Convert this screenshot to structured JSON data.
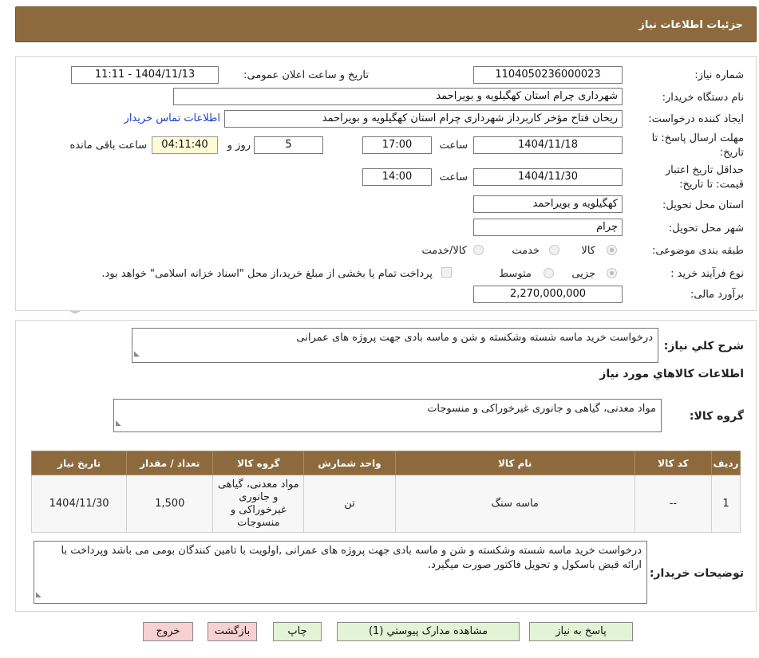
{
  "header": {
    "title": "جزئیات اطلاعات نیاز"
  },
  "watermark": {
    "text": "AriaTender.neT"
  },
  "form": {
    "need_number_label": "شماره نیاز:",
    "need_number": "1104050236000023",
    "announce_label": "تاریخ و ساعت اعلان عمومی:",
    "announce_value": "1404/11/13 - 11:11",
    "buyer_label": "نام دستگاه خریدار:",
    "buyer_value": "شهرداری چرام استان کهگیلویه و بویراحمد",
    "creator_label": "ایجاد کننده درخواست:",
    "creator_value": "ریحان فتاح مؤخر کاربرداز شهرداری چرام استان کهگیلویه و بویراحمد",
    "contact_link": "اطلاعات تماس خریدار",
    "deadline_label_1": "مهلت ارسال پاسخ: تا",
    "deadline_label_2": "تاریخ:",
    "deadline_date": "1404/11/18",
    "time_label": "ساعت",
    "deadline_time": "17:00",
    "days_value": "5",
    "days_label": "روز و",
    "remaining_time": "04:11:40",
    "remaining_label": "ساعت باقی مانده",
    "validity_label_1": "حداقل تاریخ اعتبار",
    "validity_label_2": "قیمت: تا تاریخ:",
    "validity_date": "1404/11/30",
    "validity_time": "14:00",
    "province_label": "استان محل تحویل:",
    "province_value": "کهگیلویه و بویراحمد",
    "city_label": "شهر محل تحویل:",
    "city_value": "چرام",
    "category_label": "طبقه بندی موضوعی:",
    "category_options": [
      "کالا",
      "خدمت",
      "کالا/خدمت"
    ],
    "process_label": "نوع فرآیند خرید :",
    "process_options": [
      "جزیی",
      "متوسط"
    ],
    "payment_note": "پرداخت تمام یا بخشی از مبلغ خرید،از محل \"اسناد خزانه اسلامی\" خواهد بود.",
    "budget_label": "برآورد مالی:",
    "budget_value": "2,270,000,000"
  },
  "summary": {
    "label": "شرح کلي نياز:",
    "value": "درخواست خرید ماسه شسته وشکسته  و شن و ماسه بادی جهت پروژه های عمرانی"
  },
  "goods": {
    "section_title": "اطلاعات كالاهاي مورد نياز",
    "group_label": "گروه کالا:",
    "group_value": "مواد معدنی، گیاهی و جانوری غیرخوراکی و منسوجات",
    "columns": [
      "رديف",
      "کد کالا",
      "نام کالا",
      "واحد شمارش",
      "گروه کالا",
      "تعداد / مقدار",
      "تاریخ نیاز"
    ],
    "rows": [
      {
        "index": "1",
        "code": "--",
        "name": "ماسه سنگ",
        "unit": "تن",
        "group": "مواد معدنی، گیاهی و جانوری غیرخوراکی و منسوجات",
        "qty": "1,500",
        "date": "1404/11/30"
      }
    ]
  },
  "buyer_notes": {
    "label": "توضیحات خریدار:",
    "value": "درخواست خرید ماسه شسته وشکسته  و شن و ماسه بادی جهت پروژه های عمرانی ,اولویت با تامین کنندگان بومی می باشد وپرداخت با ارائه قبض باسکول و تحویل فاکتور صورت میگیرد."
  },
  "buttons": {
    "reply": "پاسخ به نياز",
    "attachments": "مشاهده مدارک پيوستي (1)",
    "print": "چاپ",
    "back": "بازگشت",
    "exit": "خروج"
  }
}
